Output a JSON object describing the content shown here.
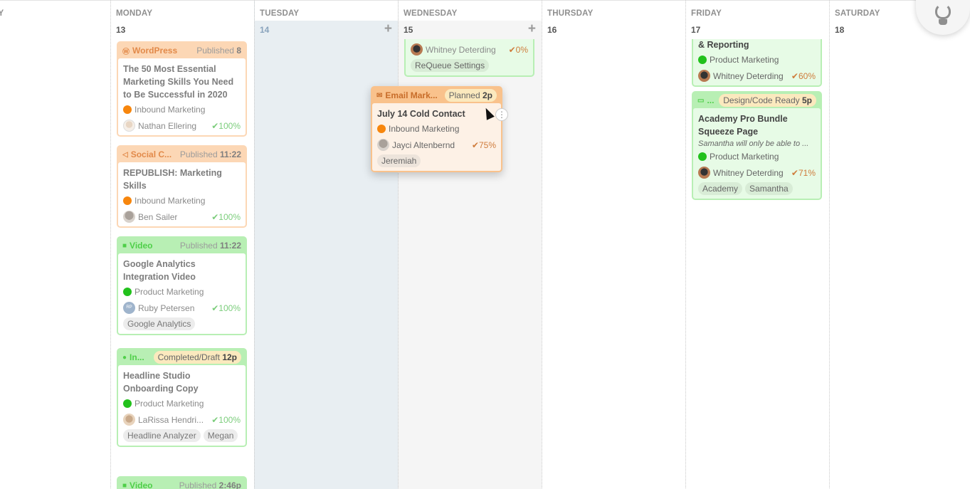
{
  "days": [
    {
      "name": "AY",
      "num": ""
    },
    {
      "name": "MONDAY",
      "num": "13"
    },
    {
      "name": "TUESDAY",
      "num": "14"
    },
    {
      "name": "WEDNESDAY",
      "num": "15"
    },
    {
      "name": "THURSDAY",
      "num": "16"
    },
    {
      "name": "FRIDAY",
      "num": "17"
    },
    {
      "name": "SATURDAY",
      "num": "18"
    }
  ],
  "add_label": "+",
  "monday": [
    {
      "type": "WordPress",
      "icon": "wordpress-icon",
      "glyph": "Ⓦ",
      "status": "Published",
      "time": "8",
      "title": "The 50 Most Essential Marketing Skills You Need to Be Successful in 2020",
      "category": "Inbound Marketing",
      "owner": "Nathan Ellering",
      "progress": "✔100%"
    },
    {
      "type": "Social C...",
      "icon": "megaphone-icon",
      "glyph": "📢",
      "status": "Published",
      "time": "11:22",
      "title": "REPUBLISH: Marketing Skills",
      "category": "Inbound Marketing",
      "owner": "Ben Sailer",
      "progress": "✔100%"
    },
    {
      "type": "Video",
      "icon": "video-camera-icon",
      "glyph": "■",
      "status": "Published",
      "time": "11:22",
      "title": "Google Analytics Integration Video",
      "category": "Product Marketing",
      "owner": "Ruby Petersen",
      "owner_initials": "RP",
      "progress": "✔100%",
      "tags": [
        "Google Analytics"
      ]
    },
    {
      "type": "In...",
      "icon": "chat-bubble-icon",
      "glyph": "●",
      "status": "Completed/Draft",
      "time": "12p",
      "title": "Headline Studio Onboarding Copy",
      "category": "Product Marketing",
      "owner": "LaRissa Hendri...",
      "progress": "✔100%",
      "tags": [
        "Headline Analyzer",
        "Megan"
      ]
    },
    {
      "type": "Video",
      "icon": "video-camera-icon",
      "glyph": "■",
      "status": "Published",
      "time": "2:46p"
    }
  ],
  "wednesday": {
    "partial": {
      "owner": "Whitney Deterding",
      "progress": "✔0%",
      "tags": [
        "ReQueue Settings"
      ]
    },
    "dragging": {
      "type": "Email Mark...",
      "icon": "envelope-icon",
      "glyph": "✉",
      "status": "Planned",
      "time": "2p",
      "title": "July 14 Cold Contact",
      "category": "Inbound Marketing",
      "owner": "Jayci Altenbernd",
      "progress": "✔75%",
      "tags": [
        "Jeremiah"
      ],
      "more_label": "⋮"
    }
  },
  "friday": {
    "partial": {
      "title": "& Reporting",
      "category": "Product Marketing",
      "owner": "Whitney Deterding",
      "progress": "✔60%"
    },
    "card": {
      "type": "...",
      "icon": "monitor-icon",
      "glyph": "▭",
      "status": "Design/Code Ready",
      "time": "5p",
      "title": "Academy Pro Bundle Squeeze Page",
      "note": "Samantha will only be able to ...",
      "category": "Product Marketing",
      "owner": "Whitney Deterding",
      "progress": "✔71%",
      "tags": [
        "Academy",
        "Samantha"
      ]
    }
  },
  "colors": {
    "orange_card": "#fcd7b5",
    "green_card": "#b8efb4",
    "inbound_dot": "#f7860d",
    "product_dot": "#22c11c",
    "today_bg": "#e8eef2",
    "selected_bg": "#f5f5f5"
  }
}
